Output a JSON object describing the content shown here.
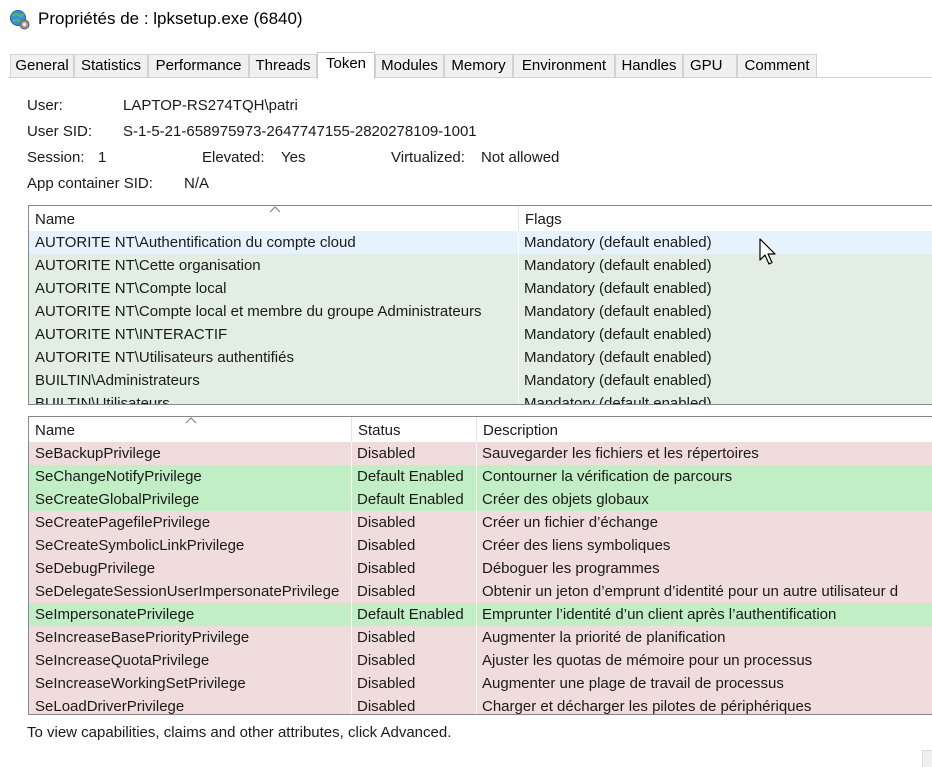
{
  "window": {
    "title": "Propriétés de : lpksetup.exe (6840)"
  },
  "tabs": [
    "General",
    "Statistics",
    "Performance",
    "Threads",
    "Token",
    "Modules",
    "Memory",
    "Environment",
    "Handles",
    "GPU",
    "Comment"
  ],
  "active_tab": "Token",
  "token_info": {
    "user_label": "User:",
    "user_value": "LAPTOP-RS274TQH\\patri",
    "sid_label": "User SID:",
    "sid_value": "S-1-5-21-658975973-2647747155-2820278109-1001",
    "session_label": "Session:",
    "session_value": "1",
    "elevated_label": "Elevated:",
    "elevated_value": "Yes",
    "virtualized_label": "Virtualized:",
    "virtualized_value": "Not allowed",
    "app_container_label": "App container SID:",
    "app_container_value": "N/A"
  },
  "groups_table": {
    "columns": [
      "Name",
      "Flags"
    ],
    "rows": [
      {
        "name": "AUTORITE NT\\Authentification du compte cloud",
        "flags": "Mandatory (default enabled)"
      },
      {
        "name": "AUTORITE NT\\Cette organisation",
        "flags": "Mandatory (default enabled)"
      },
      {
        "name": "AUTORITE NT\\Compte local",
        "flags": "Mandatory (default enabled)"
      },
      {
        "name": "AUTORITE NT\\Compte local et membre du groupe Administrateurs",
        "flags": "Mandatory (default enabled)"
      },
      {
        "name": "AUTORITE NT\\INTERACTIF",
        "flags": "Mandatory (default enabled)"
      },
      {
        "name": "AUTORITE NT\\Utilisateurs authentifiés",
        "flags": "Mandatory (default enabled)"
      },
      {
        "name": "BUILTIN\\Administrateurs",
        "flags": "Mandatory (default enabled)"
      },
      {
        "name": "BUILTIN\\Utilisateurs",
        "flags": "Mandatory (default enabled)"
      }
    ]
  },
  "privileges_table": {
    "columns": [
      "Name",
      "Status",
      "Description"
    ],
    "rows": [
      {
        "name": "SeBackupPrivilege",
        "status": "Disabled",
        "description": "Sauvegarder les fichiers et les répertoires"
      },
      {
        "name": "SeChangeNotifyPrivilege",
        "status": "Default Enabled",
        "description": "Contourner la vérification de parcours"
      },
      {
        "name": "SeCreateGlobalPrivilege",
        "status": "Default Enabled",
        "description": "Créer des objets globaux"
      },
      {
        "name": "SeCreatePagefilePrivilege",
        "status": "Disabled",
        "description": "Créer un fichier d’échange"
      },
      {
        "name": "SeCreateSymbolicLinkPrivilege",
        "status": "Disabled",
        "description": "Créer des liens symboliques"
      },
      {
        "name": "SeDebugPrivilege",
        "status": "Disabled",
        "description": "Déboguer les programmes"
      },
      {
        "name": "SeDelegateSessionUserImpersonatePrivilege",
        "status": "Disabled",
        "description": "Obtenir un jeton d’emprunt d’identité pour un autre utilisateur d"
      },
      {
        "name": "SeImpersonatePrivilege",
        "status": "Default Enabled",
        "description": "Emprunter l’identité d’un client après l’authentification"
      },
      {
        "name": "SeIncreaseBasePriorityPrivilege",
        "status": "Disabled",
        "description": "Augmenter la priorité de planification"
      },
      {
        "name": "SeIncreaseQuotaPrivilege",
        "status": "Disabled",
        "description": "Ajuster les quotas de mémoire pour un processus"
      },
      {
        "name": "SeIncreaseWorkingSetPrivilege",
        "status": "Disabled",
        "description": "Augmenter une plage de travail de processus"
      },
      {
        "name": "SeLoadDriverPrivilege",
        "status": "Disabled",
        "description": "Charger et décharger les pilotes de périphériques"
      }
    ]
  },
  "footer_note": "To view capabilities, claims and other attributes, click Advanced.",
  "colors": {
    "group_row": "#e2eee2",
    "group_row_hover": "#e6f2fc",
    "enabled_row": "#c1eec5",
    "disabled_row": "#f0dcdc"
  }
}
